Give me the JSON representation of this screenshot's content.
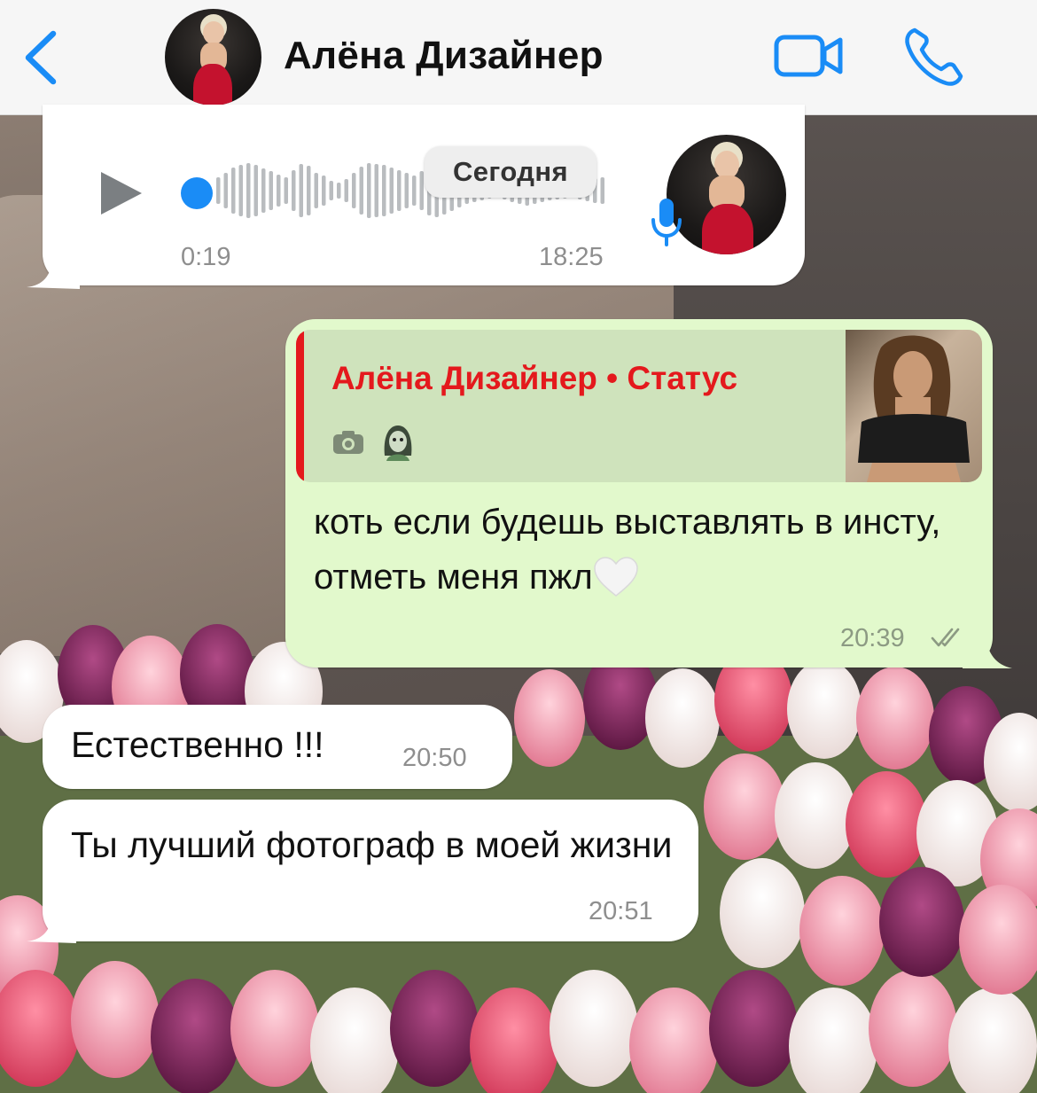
{
  "header": {
    "contact_name": "Алёна Дизайнер"
  },
  "voice_message": {
    "duration": "0:19",
    "time": "18:25",
    "progress": 0.0
  },
  "date_chip": "Сегодня",
  "reply_message": {
    "quote_title": "Алёна Дизайнер • Статус",
    "text": "коть если будешь выставлять в инсту, отметь меня пжл",
    "time": "20:39",
    "ticks": "read"
  },
  "messages": [
    {
      "text": "Естественно !!!",
      "time": "20:50"
    },
    {
      "text": "Ты лучший фотограф в моей жизни",
      "time": "20:51"
    }
  ],
  "colors": {
    "accent": "#1a8cf6",
    "status_red": "#e4191d",
    "outgoing_bubble": "#e2f9cc",
    "incoming_bubble": "#ffffff"
  },
  "icons": [
    "chevron-left-icon",
    "video-camera-icon",
    "phone-icon",
    "play-icon",
    "microphone-icon",
    "camera-icon",
    "emoji-icon",
    "heart-icon",
    "double-check-icon"
  ]
}
